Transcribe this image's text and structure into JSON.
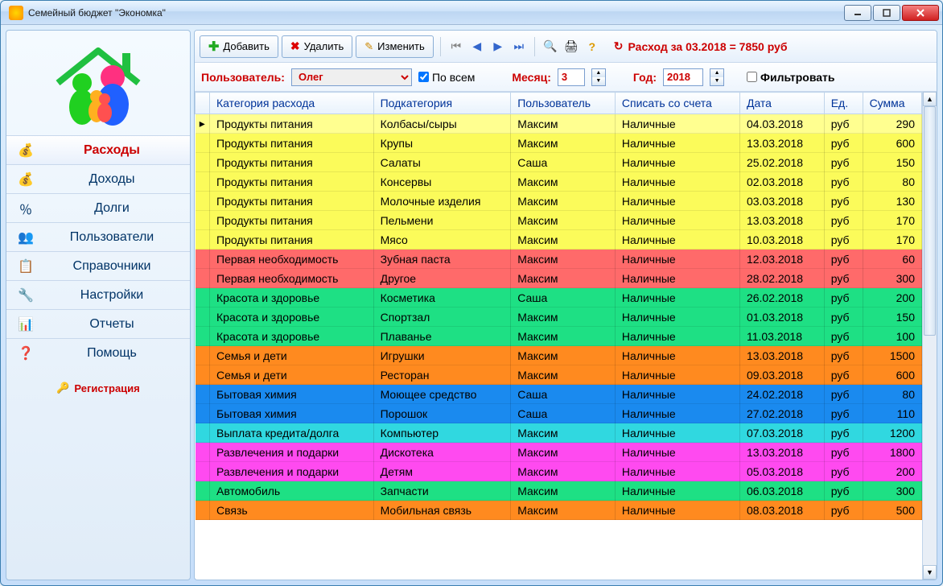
{
  "window": {
    "title": "Семейный бюджет \"Экономка\""
  },
  "sidebar": {
    "items": [
      {
        "label": "Расходы"
      },
      {
        "label": "Доходы"
      },
      {
        "label": "Долги"
      },
      {
        "label": "Пользователи"
      },
      {
        "label": "Справочники"
      },
      {
        "label": "Настройки"
      },
      {
        "label": "Отчеты"
      },
      {
        "label": "Помощь"
      }
    ],
    "registration": "Регистрация"
  },
  "toolbar": {
    "add": "Добавить",
    "delete": "Удалить",
    "edit": "Изменить",
    "summary_prefix": "Расход за 03.2018 = ",
    "summary_value": "7850 руб"
  },
  "filter": {
    "user_label": "Пользователь:",
    "user_value": "Олег",
    "by_all": "По всем",
    "month_label": "Месяц:",
    "month_value": "3",
    "year_label": "Год:",
    "year_value": "2018",
    "filter_btn": "Фильтровать"
  },
  "table": {
    "headers": [
      "Категория расхода",
      "Подкатегория",
      "Пользователь",
      "Списать со счета",
      "Дата",
      "Ед.",
      "Сумма"
    ],
    "rows": [
      {
        "c": "yellow",
        "sel": true,
        "cat": "Продукты питания",
        "sub": "Колбасы/сыры",
        "user": "Максим",
        "acc": "Наличные",
        "date": "04.03.2018",
        "unit": "руб",
        "sum": "290"
      },
      {
        "c": "yellow",
        "cat": "Продукты питания",
        "sub": "Крупы",
        "user": "Максим",
        "acc": "Наличные",
        "date": "13.03.2018",
        "unit": "руб",
        "sum": "600"
      },
      {
        "c": "yellow",
        "cat": "Продукты питания",
        "sub": "Салаты",
        "user": "Саша",
        "acc": "Наличные",
        "date": "25.02.2018",
        "unit": "руб",
        "sum": "150"
      },
      {
        "c": "yellow",
        "cat": "Продукты питания",
        "sub": "Консервы",
        "user": "Максим",
        "acc": "Наличные",
        "date": "02.03.2018",
        "unit": "руб",
        "sum": "80"
      },
      {
        "c": "yellow",
        "cat": "Продукты питания",
        "sub": "Молочные изделия",
        "user": "Максим",
        "acc": "Наличные",
        "date": "03.03.2018",
        "unit": "руб",
        "sum": "130"
      },
      {
        "c": "yellow",
        "cat": "Продукты питания",
        "sub": "Пельмени",
        "user": "Максим",
        "acc": "Наличные",
        "date": "13.03.2018",
        "unit": "руб",
        "sum": "170"
      },
      {
        "c": "yellow",
        "cat": "Продукты питания",
        "sub": "Мясо",
        "user": "Максим",
        "acc": "Наличные",
        "date": "10.03.2018",
        "unit": "руб",
        "sum": "170"
      },
      {
        "c": "red",
        "cat": "Первая необходимость",
        "sub": "Зубная паста",
        "user": "Максим",
        "acc": "Наличные",
        "date": "12.03.2018",
        "unit": "руб",
        "sum": "60"
      },
      {
        "c": "red",
        "cat": "Первая необходимость",
        "sub": "Другое",
        "user": "Максим",
        "acc": "Наличные",
        "date": "28.02.2018",
        "unit": "руб",
        "sum": "300"
      },
      {
        "c": "green",
        "cat": "Красота и здоровье",
        "sub": "Косметика",
        "user": "Саша",
        "acc": "Наличные",
        "date": "26.02.2018",
        "unit": "руб",
        "sum": "200"
      },
      {
        "c": "green",
        "cat": "Красота и здоровье",
        "sub": "Спортзал",
        "user": "Максим",
        "acc": "Наличные",
        "date": "01.03.2018",
        "unit": "руб",
        "sum": "150"
      },
      {
        "c": "green",
        "cat": "Красота и здоровье",
        "sub": "Плаванье",
        "user": "Максим",
        "acc": "Наличные",
        "date": "11.03.2018",
        "unit": "руб",
        "sum": "100"
      },
      {
        "c": "orange",
        "cat": "Семья и дети",
        "sub": "Игрушки",
        "user": "Максим",
        "acc": "Наличные",
        "date": "13.03.2018",
        "unit": "руб",
        "sum": "1500"
      },
      {
        "c": "orange",
        "cat": "Семья и дети",
        "sub": "Ресторан",
        "user": "Максим",
        "acc": "Наличные",
        "date": "09.03.2018",
        "unit": "руб",
        "sum": "600"
      },
      {
        "c": "blue",
        "cat": "Бытовая химия",
        "sub": "Моющее средство",
        "user": "Саша",
        "acc": "Наличные",
        "date": "24.02.2018",
        "unit": "руб",
        "sum": "80"
      },
      {
        "c": "blue",
        "cat": "Бытовая химия",
        "sub": "Порошок",
        "user": "Саша",
        "acc": "Наличные",
        "date": "27.02.2018",
        "unit": "руб",
        "sum": "110"
      },
      {
        "c": "cyan",
        "cat": "Выплата кредита/долга",
        "sub": "Компьютер",
        "user": "Максим",
        "acc": "Наличные",
        "date": "07.03.2018",
        "unit": "руб",
        "sum": "1200"
      },
      {
        "c": "pink",
        "cat": "Развлечения и подарки",
        "sub": "Дискотека",
        "user": "Максим",
        "acc": "Наличные",
        "date": "13.03.2018",
        "unit": "руб",
        "sum": "1800"
      },
      {
        "c": "pink",
        "cat": "Развлечения и подарки",
        "sub": "Детям",
        "user": "Максим",
        "acc": "Наличные",
        "date": "05.03.2018",
        "unit": "руб",
        "sum": "200"
      },
      {
        "c": "green",
        "cat": "Автомобиль",
        "sub": "Запчасти",
        "user": "Максим",
        "acc": "Наличные",
        "date": "06.03.2018",
        "unit": "руб",
        "sum": "300"
      },
      {
        "c": "orange",
        "cat": "Связь",
        "sub": "Мобильная связь",
        "user": "Максим",
        "acc": "Наличные",
        "date": "08.03.2018",
        "unit": "руб",
        "sum": "500"
      }
    ]
  }
}
